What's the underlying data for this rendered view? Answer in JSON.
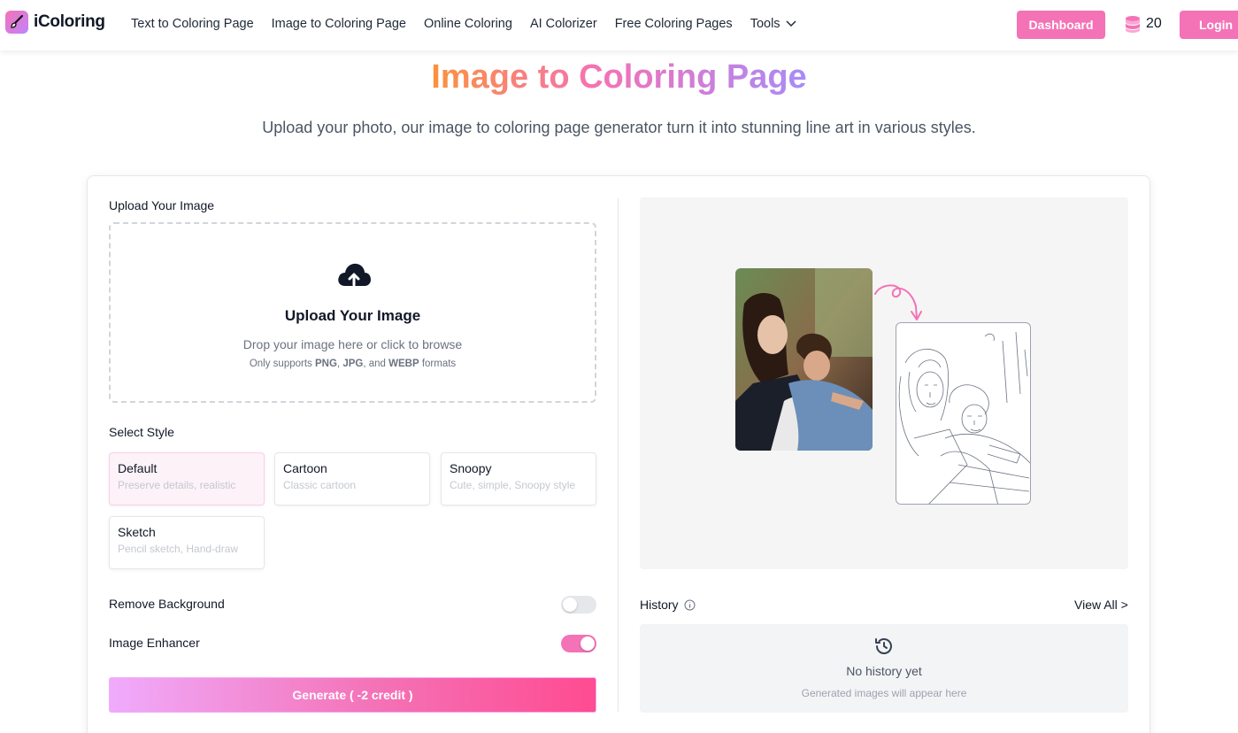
{
  "header": {
    "logo_text": "iColoring",
    "nav": [
      "Text to Coloring Page",
      "Image to Coloring Page",
      "Online Coloring",
      "AI Colorizer",
      "Free Coloring Pages",
      "Tools"
    ],
    "dashboard_label": "Dashboard",
    "credits": "20",
    "login_label": "Login"
  },
  "hero": {
    "title": "Image to Coloring Page",
    "subtitle": "Upload your photo, our image to coloring page generator turn it into stunning line art in various styles."
  },
  "upload": {
    "section_label": "Upload Your Image",
    "title": "Upload Your Image",
    "hint": "Drop your image here or click to browse",
    "formats_prefix": "Only supports",
    "format_1": "PNG",
    "format_2": "JPG",
    "formats_and": "and",
    "format_3": "WEBP",
    "formats_suffix": "formats"
  },
  "styles": {
    "section_label": "Select Style",
    "selected": "Default",
    "items": [
      {
        "name": "Default",
        "desc": "Preserve details, realistic"
      },
      {
        "name": "Cartoon",
        "desc": "Classic cartoon"
      },
      {
        "name": "Snoopy",
        "desc": "Cute, simple, Snoopy style"
      },
      {
        "name": "Sketch",
        "desc": "Pencil sketch, Hand-draw"
      }
    ]
  },
  "options": {
    "remove_background": {
      "label": "Remove Background",
      "enabled": false
    },
    "image_enhancer": {
      "label": "Image Enhancer",
      "enabled": true
    }
  },
  "generate_label": "Generate ( -2 credit )",
  "history": {
    "label": "History",
    "view_all": "View All >",
    "empty_title": "No history yet",
    "empty_sub": "Generated images will appear here"
  },
  "colors": {
    "accent": "#f472b6",
    "toggle_off": "#e5e7eb"
  }
}
